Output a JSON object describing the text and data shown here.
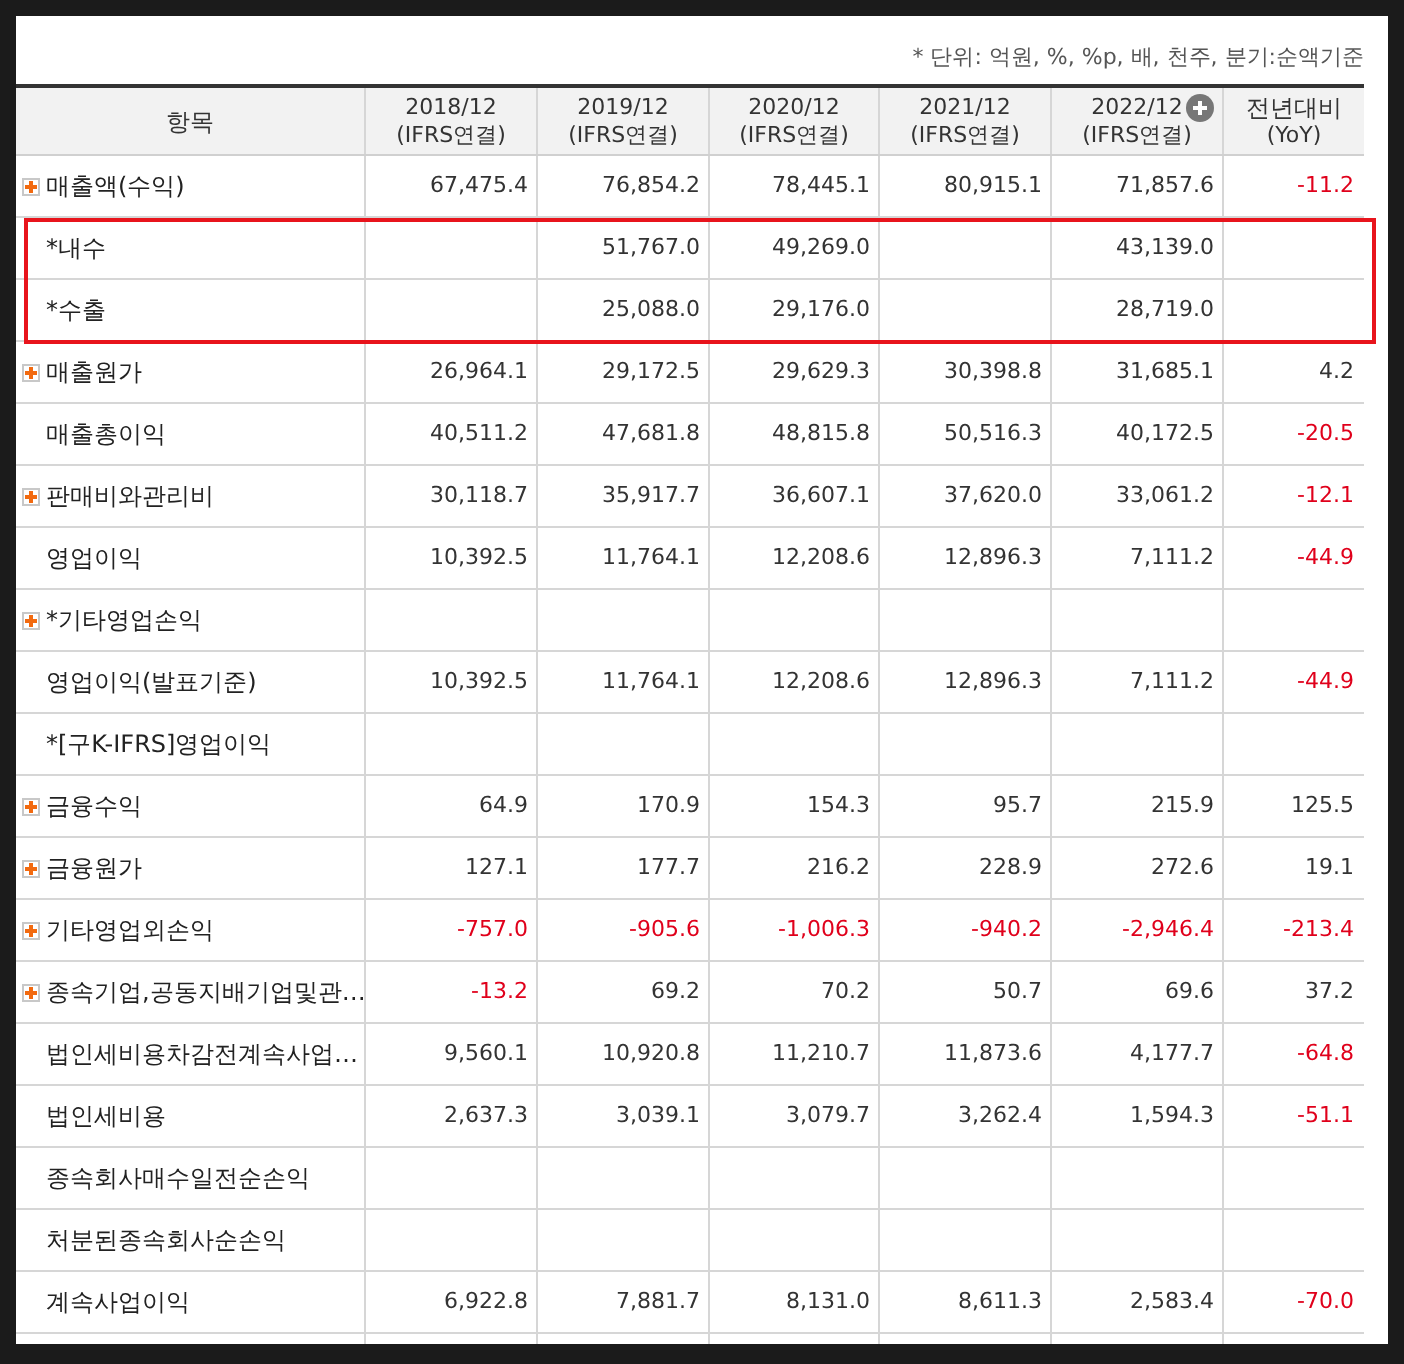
{
  "unit_note": "* 단위: 억원, %, %p, 배, 천주, 분기:순액기준",
  "columns": [
    {
      "label": "항목",
      "expandable": false
    },
    {
      "label": "2018/12",
      "sub": "(IFRS연결)",
      "expandable": false
    },
    {
      "label": "2019/12",
      "sub": "(IFRS연결)",
      "expandable": false
    },
    {
      "label": "2020/12",
      "sub": "(IFRS연결)",
      "expandable": false
    },
    {
      "label": "2021/12",
      "sub": "(IFRS연결)",
      "expandable": false
    },
    {
      "label": "2022/12",
      "sub": "(IFRS연결)",
      "expandable": true
    },
    {
      "label": "전년대비",
      "sub": "(YoY)",
      "expandable": false
    }
  ],
  "rows": [
    {
      "item": "매출액(수익)",
      "expandable": true,
      "highlighted": false,
      "y2018": "67,475.4",
      "y2019": "76,854.2",
      "y2020": "78,445.1",
      "y2021": "80,915.1",
      "y2022": "71,857.6",
      "yoy": "-11.2"
    },
    {
      "item": "*내수",
      "expandable": false,
      "highlighted": true,
      "y2019": "51,767.0",
      "y2020": "49,269.0",
      "y2022": "43,139.0"
    },
    {
      "item": "*수출",
      "expandable": false,
      "highlighted": true,
      "y2019": "25,088.0",
      "y2020": "29,176.0",
      "y2022": "28,719.0"
    },
    {
      "item": "매출원가",
      "expandable": true,
      "highlighted": false,
      "y2018": "26,964.1",
      "y2019": "29,172.5",
      "y2020": "29,629.3",
      "y2021": "30,398.8",
      "y2022": "31,685.1",
      "yoy": "4.2"
    },
    {
      "item": "매출총이익",
      "expandable": false,
      "highlighted": false,
      "y2018": "40,511.2",
      "y2019": "47,681.8",
      "y2020": "48,815.8",
      "y2021": "50,516.3",
      "y2022": "40,172.5",
      "yoy": "-20.5"
    },
    {
      "item": "판매비와관리비",
      "expandable": true,
      "highlighted": false,
      "y2018": "30,118.7",
      "y2019": "35,917.7",
      "y2020": "36,607.1",
      "y2021": "37,620.0",
      "y2022": "33,061.2",
      "yoy": "-12.1"
    },
    {
      "item": "영업이익",
      "expandable": false,
      "highlighted": false,
      "y2018": "10,392.5",
      "y2019": "11,764.1",
      "y2020": "12,208.6",
      "y2021": "12,896.3",
      "y2022": "7,111.2",
      "yoy": "-44.9"
    },
    {
      "item": "*기타영업손익",
      "expandable": true,
      "highlighted": false
    },
    {
      "item": "영업이익(발표기준)",
      "expandable": false,
      "highlighted": false,
      "y2018": "10,392.5",
      "y2019": "11,764.1",
      "y2020": "12,208.6",
      "y2021": "12,896.3",
      "y2022": "7,111.2",
      "yoy": "-44.9"
    },
    {
      "item": "*[구K-IFRS]영업이익",
      "expandable": false,
      "highlighted": false
    },
    {
      "item": "금융수익",
      "expandable": true,
      "highlighted": false,
      "y2018": "64.9",
      "y2019": "170.9",
      "y2020": "154.3",
      "y2021": "95.7",
      "y2022": "215.9",
      "yoy": "125.5"
    },
    {
      "item": "금융원가",
      "expandable": true,
      "highlighted": false,
      "y2018": "127.1",
      "y2019": "177.7",
      "y2020": "216.2",
      "y2021": "228.9",
      "y2022": "272.6",
      "yoy": "19.1"
    },
    {
      "item": "기타영업외손익",
      "expandable": true,
      "highlighted": false,
      "y2018": "-757.0",
      "y2019": "-905.6",
      "y2020": "-1,006.3",
      "y2021": "-940.2",
      "y2022": "-2,946.4",
      "yoy": "-213.4"
    },
    {
      "item": "종속기업,공동지배기업및관…",
      "expandable": true,
      "highlighted": false,
      "y2018": "-13.2",
      "y2019": "69.2",
      "y2020": "70.2",
      "y2021": "50.7",
      "y2022": "69.6",
      "yoy": "37.2"
    },
    {
      "item": "법인세비용차감전계속사업…",
      "expandable": false,
      "highlighted": false,
      "y2018": "9,560.1",
      "y2019": "10,920.8",
      "y2020": "11,210.7",
      "y2021": "11,873.6",
      "y2022": "4,177.7",
      "yoy": "-64.8"
    },
    {
      "item": "법인세비용",
      "expandable": false,
      "highlighted": false,
      "y2018": "2,637.3",
      "y2019": "3,039.1",
      "y2020": "3,079.7",
      "y2021": "3,262.4",
      "y2022": "1,594.3",
      "yoy": "-51.1"
    },
    {
      "item": "종속회사매수일전순손익",
      "expandable": false,
      "highlighted": false
    },
    {
      "item": "처분된종속회사순손익",
      "expandable": false,
      "highlighted": false
    },
    {
      "item": "계속사업이익",
      "expandable": false,
      "highlighted": false,
      "y2018": "6,922.8",
      "y2019": "7,881.7",
      "y2020": "8,131.0",
      "y2021": "8,611.3",
      "y2022": "2,583.4",
      "yoy": "-70.0"
    }
  ]
}
